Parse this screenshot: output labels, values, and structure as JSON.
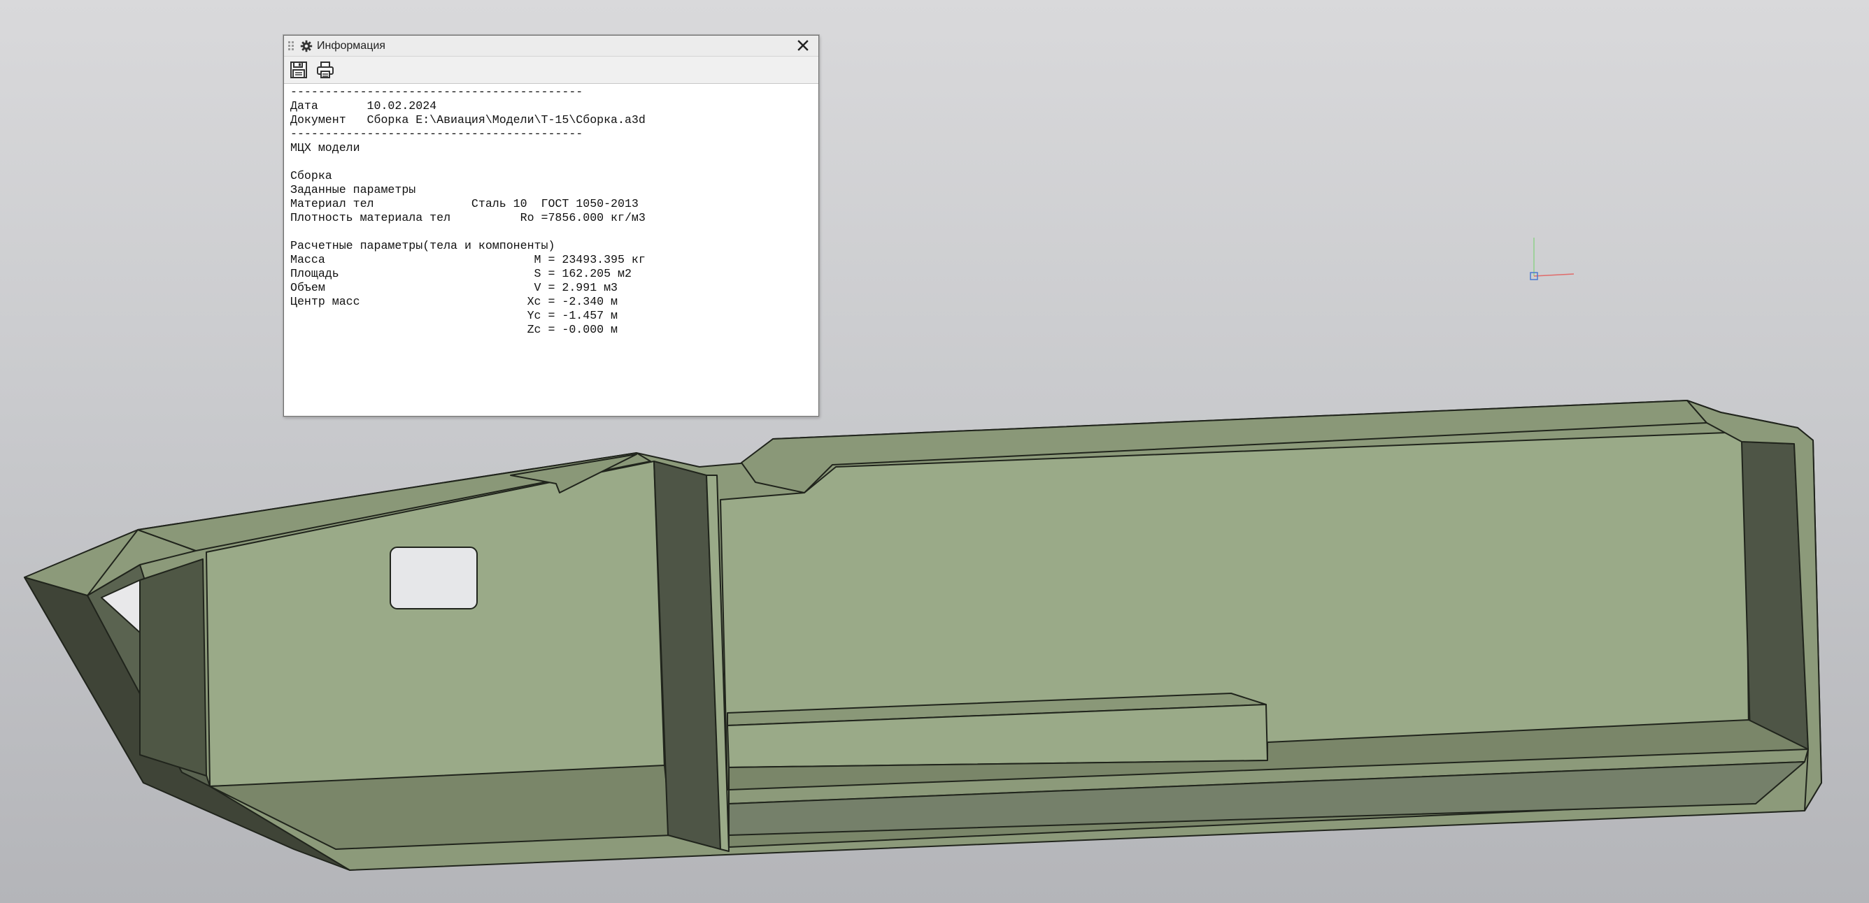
{
  "colors": {
    "background_top": "#d9d9db",
    "background_bottom": "#b4b5b9",
    "model_face_light": "#9aaa88",
    "model_face_mid": "#7e8b6e",
    "model_face_dark": "#4e5546",
    "model_edge": "#20241c"
  },
  "info_panel": {
    "title": "Информация",
    "title_icon": "gear-icon",
    "close_icon": "close-icon",
    "toolbar": {
      "save_icon": "save-icon",
      "print_icon": "print-icon"
    },
    "report_lines": [
      "------------------------------------------",
      "Дата       10.02.2024",
      "Документ   Сборка E:\\Авиация\\Модели\\Т-15\\Сборка.a3d",
      "------------------------------------------",
      "МЦХ модели",
      "",
      "Сборка",
      "Заданные параметры",
      "Материал тел              Сталь 10  ГОСТ 1050-2013",
      "Плотность материала тел          Ro =7856.000 кг/м3",
      "",
      "Расчетные параметры(тела и компоненты)",
      "Масса                              M = 23493.395 кг",
      "Площадь                            S = 162.205 м2",
      "Объем                              V = 2.991 м3",
      "Центр масс                        Xc = -2.340 м",
      "                                  Yc = -1.457 м",
      "                                  Zc = -0.000 м"
    ]
  }
}
